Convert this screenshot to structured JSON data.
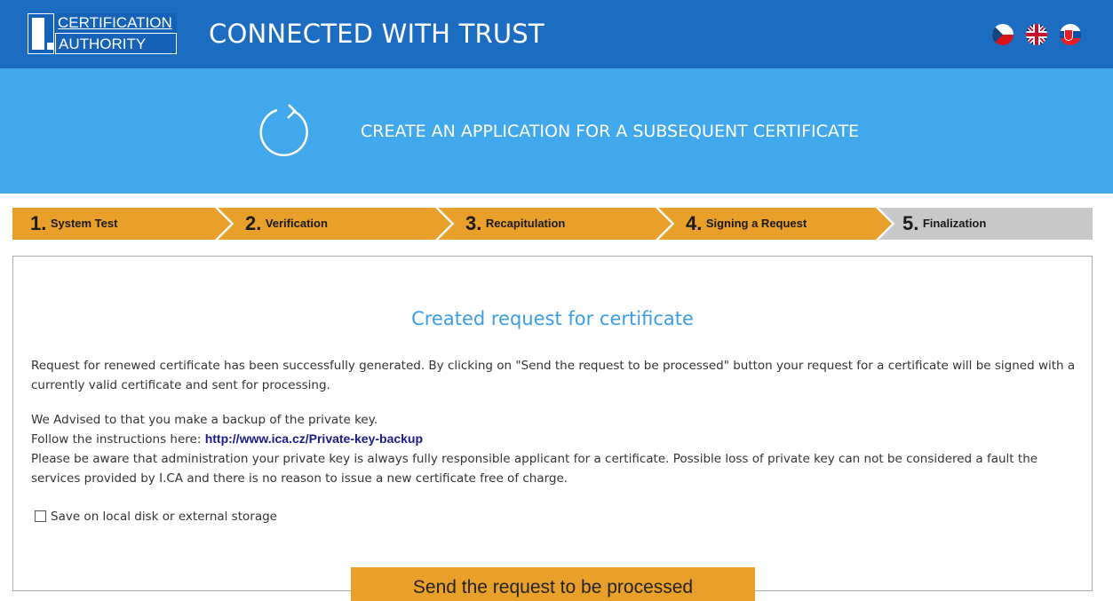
{
  "header": {
    "logo_line1": "CERTIFICATION",
    "logo_line2": "AUTHORITY",
    "slogan": "CONNECTED WITH TRUST",
    "flags": [
      "czech-flag-icon",
      "english-flag-icon",
      "slovak-flag-icon"
    ]
  },
  "banner": {
    "icon": "refresh-icon",
    "title": "CREATE AN APPLICATION FOR A SUBSEQUENT CERTIFICATE"
  },
  "steps": [
    {
      "num": "1.",
      "label": "System Test",
      "state": "done"
    },
    {
      "num": "2.",
      "label": "Verification",
      "state": "done"
    },
    {
      "num": "3.",
      "label": "Recapitulation",
      "state": "done"
    },
    {
      "num": "4.",
      "label": "Signing a Request",
      "state": "done"
    },
    {
      "num": "5.",
      "label": "Finalization",
      "state": "current"
    }
  ],
  "content": {
    "title": "Created request for certificate",
    "paragraph1": "Request for renewed certificate has been successfully generated. By clicking on \"Send the request to be processed\" button your request for a certificate will be signed with a currently valid certificate and sent for processing.",
    "advice": "We Advised to that you make a backup of the private key.",
    "instructions_label": "Follow the instructions here:",
    "instructions_link": "http://www.ica.cz/Private-key-backup",
    "warning": "Please be aware that administration your private key is always fully responsible applicant for a certificate. Possible loss of private key can not be considered a fault the services provided by I.CA and there is no reason to issue a new certificate free of charge.",
    "checkbox_label": "Save on local disk or external storage",
    "checkbox_checked": false
  },
  "send_button": "Send the request to be processed",
  "colors": {
    "header": "#1c6dc2",
    "banner": "#42a8ec",
    "step_done": "#e8a02a",
    "step_current": "#c8c8c8",
    "title_blue": "#3a9de6"
  }
}
